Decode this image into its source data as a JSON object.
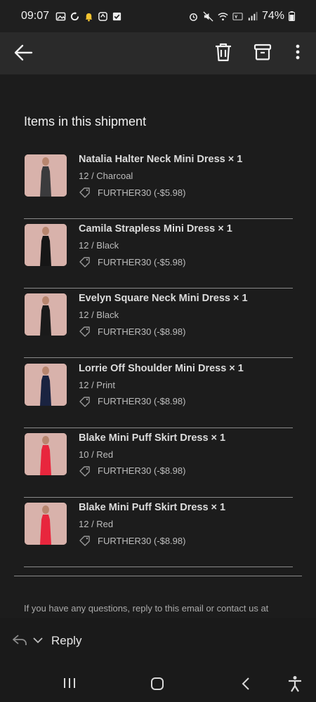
{
  "status": {
    "time": "09:07",
    "battery": "74%"
  },
  "section_title": "Items in this shipment",
  "items": [
    {
      "name": "Natalia Halter Neck Mini Dress × 1",
      "variant": "12 / Charcoal",
      "discount": "FURTHER30 (-$5.98)",
      "thumb_color": "#3b3b3d"
    },
    {
      "name": "Camila Strapless Mini Dress × 1",
      "variant": "12 / Black",
      "discount": "FURTHER30 (-$5.98)",
      "thumb_color": "#161616"
    },
    {
      "name": "Evelyn Square Neck Mini Dress × 1",
      "variant": "12 / Black",
      "discount": "FURTHER30 (-$8.98)",
      "thumb_color": "#1a1a1a"
    },
    {
      "name": "Lorrie Off Shoulder Mini Dress × 1",
      "variant": "12 / Print",
      "discount": "FURTHER30 (-$8.98)",
      "thumb_color": "#1a2340"
    },
    {
      "name": "Blake Mini Puff Skirt Dress × 1",
      "variant": "10 / Red",
      "discount": "FURTHER30 (-$8.98)",
      "thumb_color": "#e8263d"
    },
    {
      "name": "Blake Mini Puff Skirt Dress × 1",
      "variant": "12 / Red",
      "discount": "FURTHER30 (-$8.98)",
      "thumb_color": "#e8263d"
    }
  ],
  "footer_text": "If you have any questions, reply to this email or contact us at",
  "reply_label": "Reply"
}
